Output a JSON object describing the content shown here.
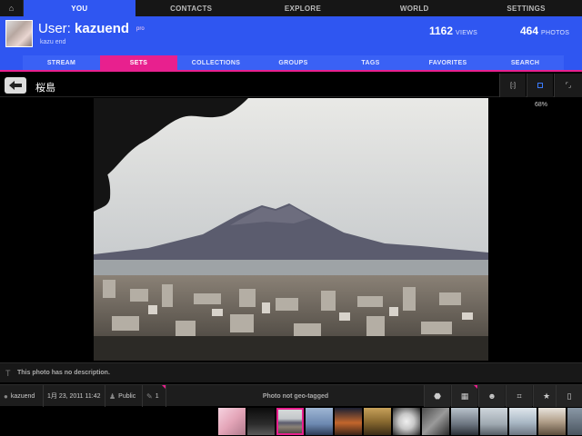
{
  "topnav": {
    "home_icon": "home-icon",
    "tabs": [
      "YOU",
      "CONTACTS",
      "EXPLORE",
      "WORLD",
      "SETTINGS"
    ],
    "active": "YOU"
  },
  "user": {
    "prefix": "User:",
    "username": "kazuend",
    "badge": "pro",
    "real_name": "kazu end",
    "views_count": "1162",
    "views_label": "VIEWS",
    "photos_count": "464",
    "photos_label": "PHOTOS"
  },
  "subtabs": {
    "items": [
      "STREAM",
      "SETS",
      "COLLECTIONS",
      "GROUPS",
      "TAGS",
      "FAVORITES",
      "SEARCH"
    ],
    "active": "SETS"
  },
  "photo": {
    "title": "桜島",
    "zoom": "68%",
    "description": "This photo has no description."
  },
  "viewmodes": [
    "fit-icon",
    "actual-size-icon",
    "fullscreen-icon"
  ],
  "infobar": {
    "owner": "kazuend",
    "date": "1月 23, 2011 11:42",
    "privacy": "Public",
    "comments": "1",
    "geo": "Photo not geo-tagged"
  },
  "actions": [
    "tag-icon",
    "grid-icon",
    "emoji-icon",
    "crop-icon",
    "star-icon",
    "phone-icon"
  ],
  "colors": {
    "accent_blue": "#2f56f1",
    "accent_pink": "#e8208e"
  },
  "filmstrip_count": 13,
  "filmstrip_selected": 2
}
